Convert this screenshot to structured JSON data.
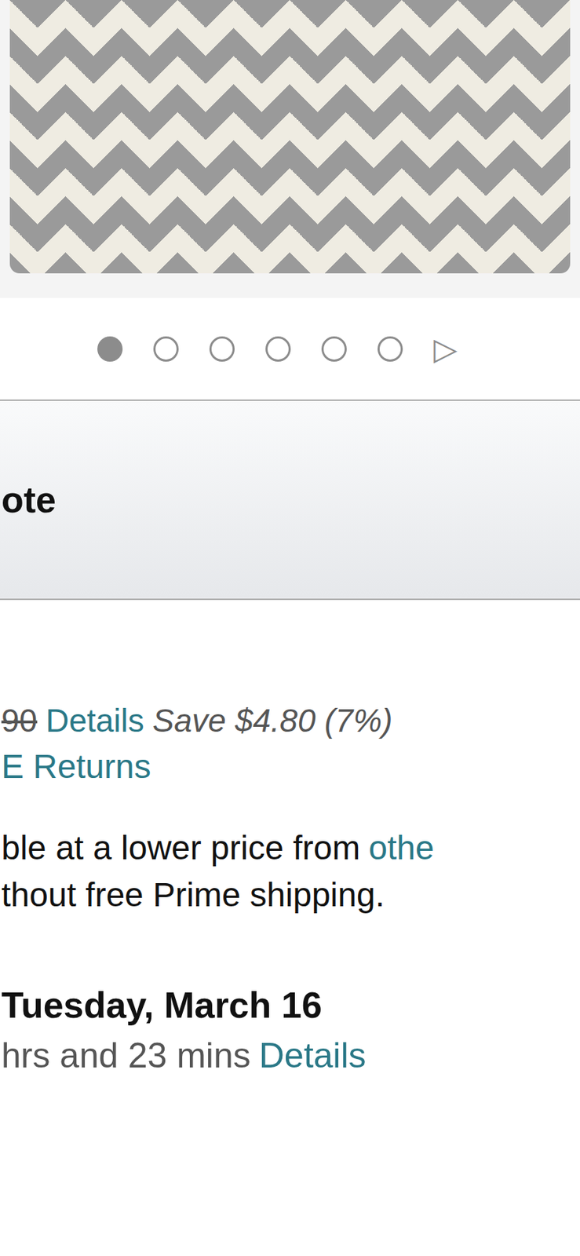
{
  "carousel": {
    "dots": [
      {
        "selected": true
      },
      {
        "selected": false
      },
      {
        "selected": false
      },
      {
        "selected": false
      },
      {
        "selected": false
      },
      {
        "selected": false
      }
    ],
    "next": "▷"
  },
  "title": "ote",
  "price": {
    "list_price": "90",
    "details": "Details",
    "savings": "Save $4.80 (7%)"
  },
  "returns": "E Returns",
  "offer": {
    "text": "ble at a lower price from",
    "link": "othe",
    "line2": "thout free Prime shipping."
  },
  "delivery": {
    "date": "Tuesday, March 16",
    "countdown": "hrs and 23 mins",
    "details": "Details"
  }
}
